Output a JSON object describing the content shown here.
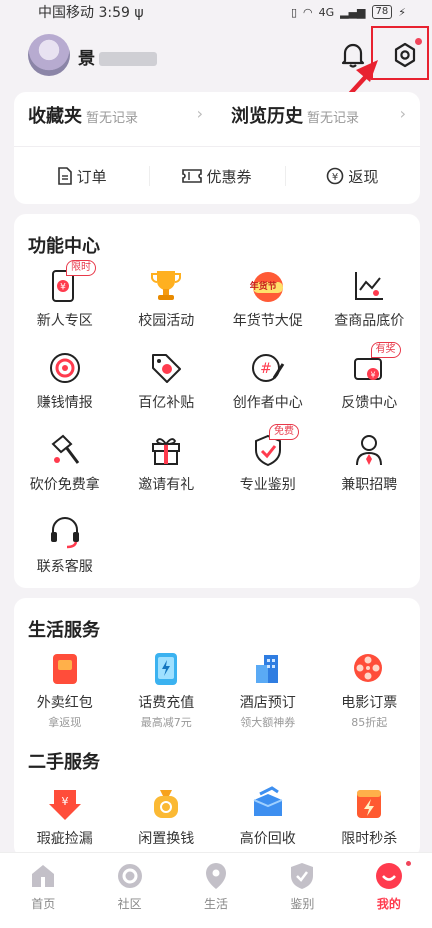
{
  "status_bar": {
    "carrier_time": "中国移动 3:59",
    "usb_symbol": "ψ",
    "signal_text": "4G",
    "battery": "78"
  },
  "header": {
    "username": "景",
    "icons": [
      "bell-icon",
      "gear-icon"
    ]
  },
  "favorites": {
    "collect_title": "收藏夹",
    "collect_sub": "暂无记录",
    "history_title": "浏览历史",
    "history_sub": "暂无记录",
    "tabs": [
      "订单",
      "优惠券",
      "返现"
    ]
  },
  "function_center": {
    "title": "功能中心",
    "items": [
      {
        "label": "新人专区",
        "badge": "限时"
      },
      {
        "label": "校园活动"
      },
      {
        "label": "年货节大促",
        "tag": "年货节"
      },
      {
        "label": "查商品底价"
      },
      {
        "label": "赚钱情报"
      },
      {
        "label": "百亿补贴"
      },
      {
        "label": "创作者中心"
      },
      {
        "label": "反馈中心",
        "badge": "有奖"
      },
      {
        "label": "砍价免费拿"
      },
      {
        "label": "邀请有礼"
      },
      {
        "label": "专业鉴别",
        "badge": "免费"
      },
      {
        "label": "兼职招聘"
      },
      {
        "label": "联系客服"
      }
    ]
  },
  "life_services": {
    "title": "生活服务",
    "items": [
      {
        "label": "外卖红包",
        "sub": "拿返现"
      },
      {
        "label": "话费充值",
        "sub": "最高减7元"
      },
      {
        "label": "酒店预订",
        "sub": "领大额神券"
      },
      {
        "label": "电影订票",
        "sub": "85折起"
      }
    ]
  },
  "second_hand": {
    "title": "二手服务",
    "items": [
      {
        "label": "瑕疵捡漏"
      },
      {
        "label": "闲置换钱"
      },
      {
        "label": "高价回收"
      },
      {
        "label": "限时秒杀"
      }
    ]
  },
  "tab_bar": {
    "items": [
      "首页",
      "社区",
      "生活",
      "鉴别",
      "我的"
    ],
    "active": "我的"
  },
  "colors": {
    "accent": "#ff3b4e",
    "highlight": "#e82230"
  }
}
